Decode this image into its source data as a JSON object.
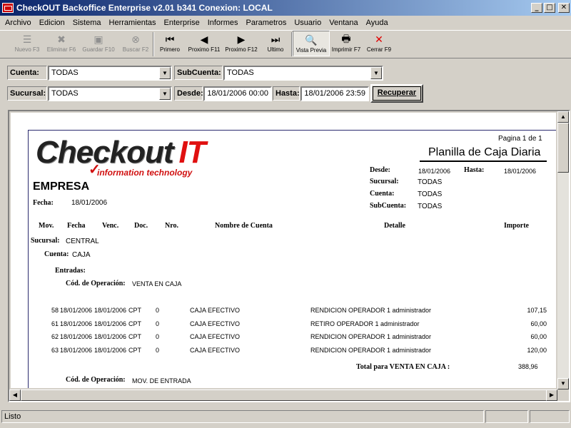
{
  "window": {
    "title": "CheckOUT Backoffice Enterprise v2.01 b341 Conexion: LOCAL",
    "minimize": "_",
    "maximize": "□",
    "close": "✕"
  },
  "menu": [
    "Archivo",
    "Edicion",
    "Sistema",
    "Herramientas",
    "Enterprise",
    "Informes",
    "Parametros",
    "Usuario",
    "Ventana",
    "Ayuda"
  ],
  "toolbar": [
    {
      "label": "Nuevo F3",
      "icon": "new-record-icon",
      "glyph": "☰",
      "enabled": false
    },
    {
      "label": "Eliminar F6",
      "icon": "delete-record-icon",
      "glyph": "✖",
      "enabled": false
    },
    {
      "label": "Guardar F10",
      "icon": "save-icon",
      "glyph": "▣",
      "enabled": false
    },
    {
      "label": "Buscar F2",
      "icon": "binoculars-icon",
      "glyph": "⊗",
      "enabled": false
    },
    {
      "label": "Primero",
      "icon": "first-icon",
      "glyph": "⏮",
      "enabled": true
    },
    {
      "label": "Proximo F11",
      "icon": "previous-icon",
      "glyph": "◀",
      "enabled": true
    },
    {
      "label": "Proximo F12",
      "icon": "next-icon",
      "glyph": "▶",
      "enabled": true
    },
    {
      "label": "Ultimo",
      "icon": "last-icon",
      "glyph": "⏭",
      "enabled": true
    },
    {
      "label": "Vista Previa",
      "icon": "preview-icon",
      "glyph": "🔍",
      "enabled": true,
      "active": true
    },
    {
      "label": "Imprimir F7",
      "icon": "printer-icon",
      "glyph": "🖶",
      "enabled": true
    },
    {
      "label": "Cerrar F9",
      "icon": "close-icon",
      "glyph": "✕",
      "enabled": true,
      "color": "#e00000"
    }
  ],
  "filters": {
    "cuenta_label": "Cuenta:",
    "cuenta_value": "TODAS",
    "subcuenta_label": "SubCuenta:",
    "subcuenta_value": "TODAS",
    "sucursal_label": "Sucursal:",
    "sucursal_value": "TODAS",
    "desde_label": "Desde:",
    "desde_value": "18/01/2006 00:00",
    "hasta_label": "Hasta:",
    "hasta_value": "18/01/2006 23:59",
    "recuperar": "Recuperar"
  },
  "report": {
    "logo_main": "Checkout",
    "logo_it": "IT",
    "logo_sub": "information technology",
    "page": "Pagina 1 de 1",
    "title": "Planilla de Caja Diaria",
    "empresa": "EMPRESA",
    "fecha_label": "Fecha:",
    "fecha_value": "18/01/2006",
    "desde_label": "Desde:",
    "desde_value": "18/01/2006",
    "hasta_label": "Hasta:",
    "hasta_value": "18/01/2006",
    "sucursal_label": "Sucursal:",
    "sucursal_value": "TODAS",
    "cuenta_label": "Cuenta:",
    "cuenta_value": "TODAS",
    "subcuenta_label": "SubCuenta:",
    "subcuenta_value": "TODAS",
    "columns": {
      "mov": "Mov.",
      "fecha": "Fecha",
      "venc": "Venc.",
      "doc": "Doc.",
      "nro": "Nro.",
      "nombre": "Nombre de Cuenta",
      "detalle": "Detalle",
      "importe": "Importe"
    },
    "grp_sucursal_label": "Sucursal:",
    "grp_sucursal_value": "CENTRAL",
    "grp_cuenta_label": "Cuenta:",
    "grp_cuenta_value": "CAJA",
    "entradas_label": "Entradas:",
    "cod_op_label": "Cód. de Operación:",
    "cod_op_1": "VENTA EN CAJA",
    "rows": [
      {
        "mov": "58",
        "fecha": "18/01/2006",
        "venc": "18/01/2006",
        "doc": "CPT",
        "nro": "0",
        "cuenta": "CAJA EFECTIVO",
        "detalle": "RENDICION OPERADOR 1 administrador",
        "importe": "107,15"
      },
      {
        "mov": "61",
        "fecha": "18/01/2006",
        "venc": "18/01/2006",
        "doc": "CPT",
        "nro": "0",
        "cuenta": "CAJA EFECTIVO",
        "detalle": "RETIRO OPERADOR 1 administrador",
        "importe": "60,00"
      },
      {
        "mov": "62",
        "fecha": "18/01/2006",
        "venc": "18/01/2006",
        "doc": "CPT",
        "nro": "0",
        "cuenta": "CAJA EFECTIVO",
        "detalle": "RENDICION OPERADOR 1 administrador",
        "importe": "60,00"
      },
      {
        "mov": "63",
        "fecha": "18/01/2006",
        "venc": "18/01/2006",
        "doc": "CPT",
        "nro": "0",
        "cuenta": "CAJA EFECTIVO",
        "detalle": "RENDICION OPERADOR 1 administrador",
        "importe": "120,00"
      }
    ],
    "total_label": "Total para VENTA EN CAJA :",
    "total_value": "388,96",
    "cod_op_2": "MOV. DE ENTRADA"
  },
  "statusbar": {
    "text": "Listo"
  }
}
